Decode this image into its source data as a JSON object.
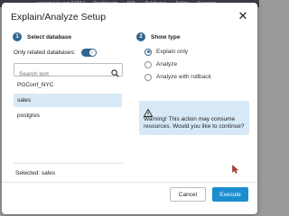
{
  "background_bar": {
    "items": [
      "seresmysen.com 5432 *",
      "Dashboards",
      "SQL",
      "Databases",
      "Tables",
      "Sessions"
    ]
  },
  "dialog": {
    "title": "Explain/Analyze Setup",
    "close_glyph": "✕",
    "step1": {
      "number": "1",
      "label": "Select database"
    },
    "step2": {
      "number": "2",
      "label": "Show type"
    },
    "related_label": "Only related databases:",
    "related_toggle_on": true,
    "search": {
      "placeholder": "Search text",
      "value": ""
    },
    "databases": [
      {
        "name": "PGConf_NYC",
        "selected": false
      },
      {
        "name": "sales",
        "selected": true
      },
      {
        "name": "postgres",
        "selected": false
      }
    ],
    "selected_text": "Selected: sales",
    "show_type_options": [
      {
        "label": "Explain only",
        "checked": true
      },
      {
        "label": "Analyze",
        "checked": false
      },
      {
        "label": "Analyze with rollback",
        "checked": false
      }
    ],
    "warning_text": "Warning! This action may consume resources. Would you like to continue?",
    "buttons": {
      "cancel": "Cancel",
      "execute": "Execute"
    }
  },
  "icons": {
    "close": "close-icon",
    "search": "search-icon",
    "warning": "warning-icon",
    "toggle_check": "check-icon",
    "cursor": "mouse-cursor-icon"
  },
  "colors": {
    "accent": "#326690",
    "primary_button": "#1b8ecf",
    "selected_row": "#d9e9f5",
    "warning_bg": "#d7e9f7",
    "cursor": "#c0392b"
  }
}
